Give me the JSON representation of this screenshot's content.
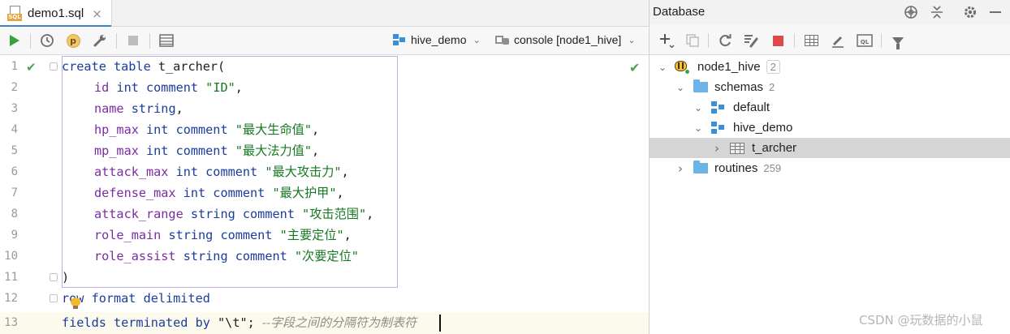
{
  "editor": {
    "tab": {
      "label": "demo1.sql",
      "close": "×",
      "icon_tag": "SQL"
    },
    "toolbar": {
      "profile_letter": "p",
      "schema_selector": "hive_demo",
      "console_selector": "console [node1_hive]",
      "dropdown_glyph": "⌄"
    },
    "line_numbers": [
      "1",
      "2",
      "3",
      "4",
      "5",
      "6",
      "7",
      "8",
      "9",
      "10",
      "11",
      "12",
      "13"
    ],
    "code": {
      "l1": {
        "kw1": "create table",
        "name": " t_archer("
      },
      "l2": {
        "col": "id",
        "type": " int comment ",
        "str": "\"ID\"",
        "end": ","
      },
      "l3": {
        "col": "name",
        "type": " string",
        "end": ","
      },
      "l4": {
        "col": "hp_max",
        "type": " int comment ",
        "str": "\"最大生命值\"",
        "end": ","
      },
      "l5": {
        "col": "mp_max",
        "type": " int comment ",
        "str": "\"最大法力值\"",
        "end": ","
      },
      "l6": {
        "col": "attack_max",
        "type": " int comment ",
        "str": "\"最大攻击力\"",
        "end": ","
      },
      "l7": {
        "col": "defense_max",
        "type": " int comment ",
        "str": "\"最大护甲\"",
        "end": ","
      },
      "l8": {
        "col": "attack_range",
        "type": " string comment ",
        "str": "\"攻击范围\"",
        "end": ","
      },
      "l9": {
        "col": "role_main",
        "type": " string comment ",
        "str": "\"主要定位\"",
        "end": ","
      },
      "l10": {
        "col": "role_assist",
        "type": " string comment ",
        "str": "\"次要定位\""
      },
      "l11": {
        "text": ")"
      },
      "l12": {
        "kw": "row format delimited"
      },
      "l13": {
        "kw": "fields terminated by ",
        "str": "\"\\t\"",
        "end": "; ",
        "comment": "--字段之间的分隔符为制表符"
      }
    }
  },
  "database": {
    "title": "Database",
    "header_icons": [
      "globe-icon",
      "collapse-icon",
      "gear-icon",
      "minimize-icon"
    ],
    "tree": [
      {
        "label": "node1_hive",
        "count": "2",
        "icon": "hive-icon",
        "chevron": "⌄"
      },
      {
        "label": "schemas",
        "count": "2",
        "icon": "folder-icon",
        "chevron": "⌄"
      },
      {
        "label": "default",
        "icon": "schema-icon",
        "chevron": "⌄"
      },
      {
        "label": "hive_demo",
        "icon": "schema-icon",
        "chevron": "⌄"
      },
      {
        "label": "t_archer",
        "icon": "table-icon",
        "chevron": "›",
        "selected": true
      },
      {
        "label": "routines",
        "count": "259",
        "icon": "folder-icon",
        "chevron": "›"
      }
    ]
  },
  "watermark": "CSDN @玩数据的小鼠",
  "colors": {
    "keyword": "#1a3c9e",
    "identifier": "#7b2ca5",
    "string": "#177a23",
    "comment": "#8c8c8c",
    "run_green": "#3ba03b",
    "stop_red": "#de4848",
    "selection": "#d5d5d5"
  }
}
